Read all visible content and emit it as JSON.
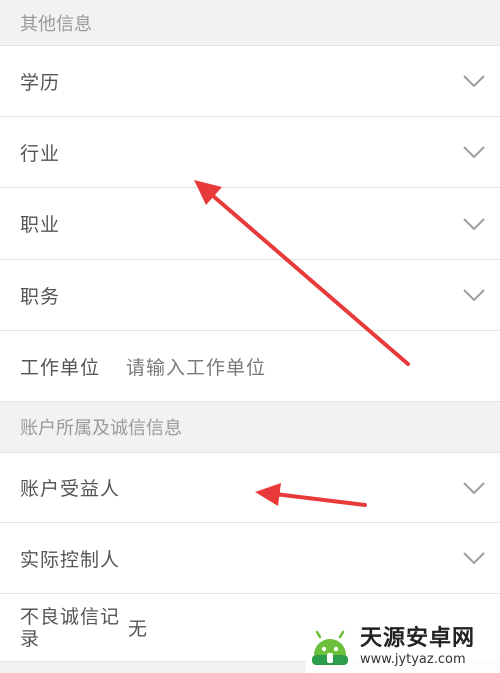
{
  "sections": {
    "other_info": "其他信息",
    "account_info": "账户所属及诚信信息"
  },
  "rows": {
    "education": "学历",
    "industry": "行业",
    "occupation": "职业",
    "position": "职务",
    "employer_label": "工作单位",
    "employer_placeholder": "请输入工作单位",
    "beneficiary": "账户受益人",
    "controller": "实际控制人",
    "credit_record_label": "不良诚信记录",
    "credit_record_value": "无"
  },
  "watermark": {
    "title": "天源安卓网",
    "url": "www.jytyaz.com"
  },
  "colors": {
    "arrow": "#e83a3a",
    "chevron": "#9e9e9e",
    "divider": "#e3e3e3"
  }
}
